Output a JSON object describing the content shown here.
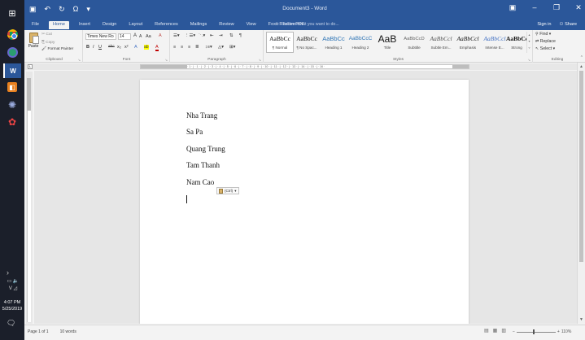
{
  "taskbar": {
    "time": "4:07 PM",
    "date": "5/25/2019"
  },
  "title": {
    "doc": "Document3 - Word",
    "qat_undo": "↶",
    "qat_redo": "↻",
    "qat_save": "💾",
    "qat_omega": "Ω"
  },
  "tabs": [
    "File",
    "Home",
    "Insert",
    "Design",
    "Layout",
    "References",
    "Mailings",
    "Review",
    "View",
    "Foxit Reader PDF"
  ],
  "tellme": "Tell me what you want to do...",
  "account": {
    "signin": "Sign in",
    "share": "Share"
  },
  "ribbon": {
    "clipboard": {
      "label": "Clipboard",
      "paste": "Paste",
      "cut": "Cut",
      "copy": "Copy",
      "format_painter": "Format Painter"
    },
    "font": {
      "label": "Font",
      "font_name": "Times New Ro",
      "font_size": "14",
      "bold": "B",
      "italic": "I",
      "underline": "U",
      "strike": "abc",
      "subscript": "x₂",
      "superscript": "x²",
      "grow": "A",
      "shrink": "A",
      "change_case": "Aa",
      "clear": "A",
      "text_effects": "A",
      "highlight": "ab",
      "font_color": "A"
    },
    "paragraph": {
      "label": "Paragraph"
    },
    "styles": {
      "label": "Styles",
      "items": [
        {
          "preview": "AaBbCc",
          "name": "¶ Normal"
        },
        {
          "preview": "AaBbCc",
          "name": "¶ No Spac..."
        },
        {
          "preview": "AaBbCc",
          "name": "Heading 1"
        },
        {
          "preview": "AaBbCcC",
          "name": "Heading 2"
        },
        {
          "preview": "AaB",
          "name": "Title"
        },
        {
          "preview": "AaBbCcD",
          "name": "Subtitle"
        },
        {
          "preview": "AaBbCcl",
          "name": "Subtle Em..."
        },
        {
          "preview": "AaBbCcl",
          "name": "Emphasis"
        },
        {
          "preview": "AaBbCcl",
          "name": "Intense E..."
        },
        {
          "preview": "AaBbCc",
          "name": "Strong"
        }
      ]
    },
    "editing": {
      "label": "Editing",
      "find": "Find",
      "replace": "Replace",
      "select": "Select"
    }
  },
  "ruler_ticks": "· 1 · | · 1 · | · 2 · | · 3 · | · 4 · | · 5 · | · 6 · | · 7 · | · 8 · | · 9 · | · 10 · | · 11 · | · 12 · | · 13 · | · 14 · | · 15 · | · 16 ·",
  "document": {
    "paragraphs": [
      "Nha Trang",
      "Sa Pa",
      "Quang Trung",
      "Tam Thanh",
      "Nam Cao"
    ],
    "paste_options": "(Ctrl)"
  },
  "status": {
    "page": "Page 1 of 1",
    "words": "10 words",
    "zoom": "110%"
  },
  "colors": {
    "word_blue": "#2b579a"
  }
}
